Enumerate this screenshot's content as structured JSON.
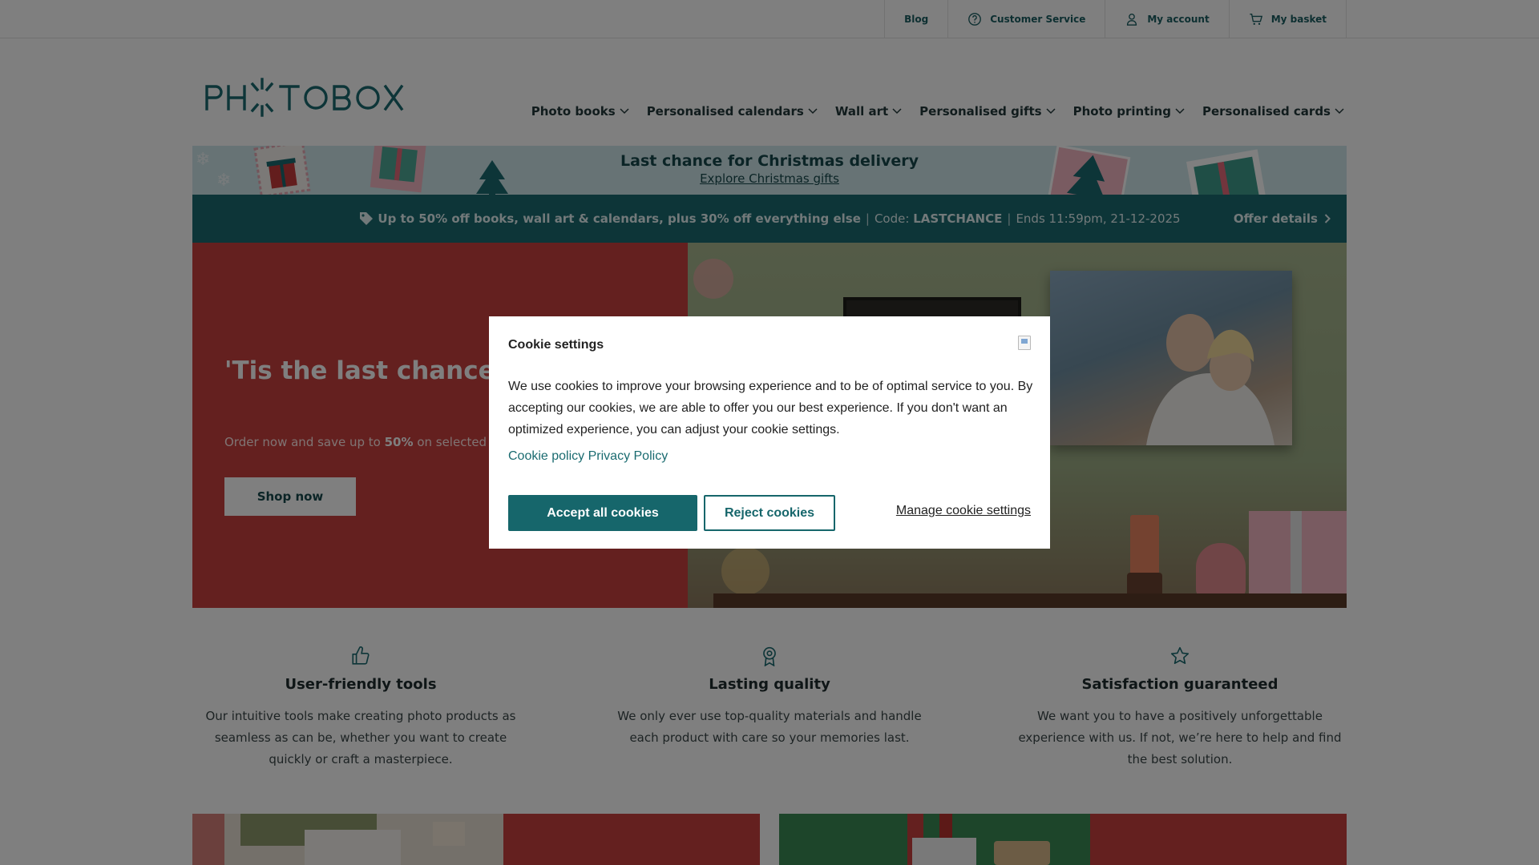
{
  "topbar": {
    "links": [
      {
        "label": "Blog",
        "icon": null
      },
      {
        "label": "Customer Service",
        "icon": "help-circle-icon"
      },
      {
        "label": "My account",
        "icon": "user-icon"
      },
      {
        "label": "My basket",
        "icon": "basket-icon"
      }
    ]
  },
  "header": {
    "logo_text": "PHOTOBOX",
    "nav": [
      {
        "label": "Photo books"
      },
      {
        "label": "Personalised calendars"
      },
      {
        "label": "Wall art"
      },
      {
        "label": "Personalised gifts"
      },
      {
        "label": "Photo printing"
      },
      {
        "label": "Personalised cards"
      }
    ]
  },
  "christmas_banner": {
    "title": "Last chance for Christmas delivery",
    "link": "Explore Christmas gifts"
  },
  "offer_bar": {
    "headline": "Up to 50% off books, wall art & calendars, plus 30% off everything else",
    "code_label": "Code:",
    "code": "LASTCHANCE",
    "ends": "Ends 11:59pm, 21-12-2025",
    "separator": "|",
    "details_label": "Offer details"
  },
  "hero": {
    "title": "'Tis the last chance for savings",
    "subtitle_prefix": "Order now and save up to",
    "subtitle_bold": "50%",
    "subtitle_suffix": "on selected wall",
    "button_label": "Shop now"
  },
  "features": [
    {
      "icon": "thumbs-up-icon",
      "title": "User-friendly tools",
      "text": "Our intuitive tools make creating photo products as seamless as can be, whether you want to create quickly or craft a masterpiece."
    },
    {
      "icon": "award-icon",
      "title": "Lasting quality",
      "text": "We only ever use top-quality materials and handle each product with care so your memories last."
    },
    {
      "icon": "star-icon",
      "title": "Satisfaction guaranteed",
      "text": "We want you to have a positively unforgettable experience with us. If not, we’re here to help and find the best solution."
    }
  ],
  "cookie_modal": {
    "title": "Cookie settings",
    "body": "We use cookies to improve your browsing experience and to be of optimal service to you. By accepting our cookies, we are able to offer you our best experience. If you don't want an optimized experience, you can adjust your cookie settings.",
    "link_cookie_policy": "Cookie policy",
    "link_privacy_policy": "Privacy Policy",
    "accept_label": "Accept all cookies",
    "reject_label": "Reject cookies",
    "manage_label": "Manage cookie settings"
  },
  "colors": {
    "brand_teal": "#1a6b70",
    "hero_red": "#c9403f",
    "banner_mint": "#cfe7ea"
  }
}
